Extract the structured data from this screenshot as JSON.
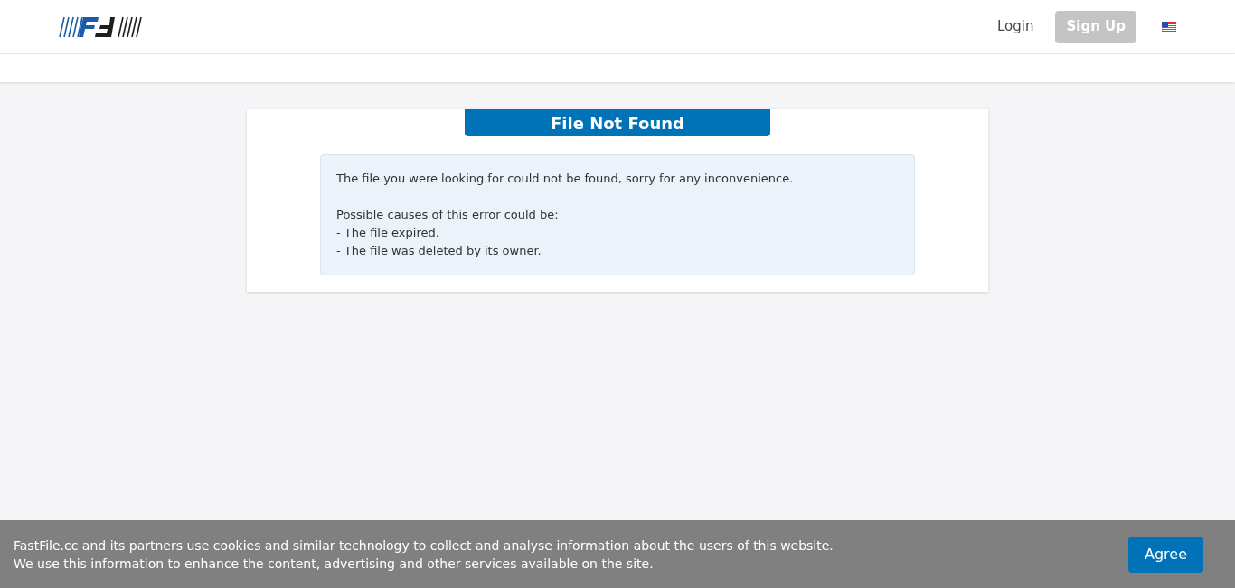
{
  "header": {
    "login": "Login",
    "signup": "Sign Up"
  },
  "error": {
    "title": "File Not Found",
    "message": "The file you were looking for could not be found, sorry for any inconvenience.",
    "causes_heading": "Possible causes of this error could be:",
    "causes": [
      "- The file expired.",
      "- The file was deleted by its owner."
    ]
  },
  "cookie_bar": {
    "lines": [
      "FastFile.cc and its partners use cookies and similar technology to collect and analyse information about the users of this website.",
      "We use this information to enhance the content, advertising and other services available on the site."
    ],
    "button": "Agree"
  }
}
